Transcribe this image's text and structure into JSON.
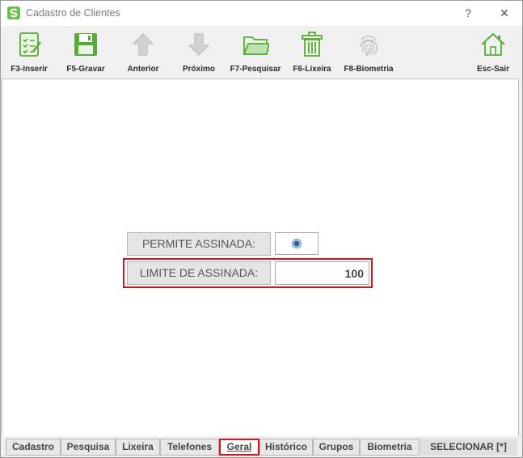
{
  "window": {
    "title": "Cadastro de Clientes",
    "help_glyph": "?",
    "close_glyph": "✕",
    "accent_color": "#6bbf4a"
  },
  "toolbar": {
    "items": [
      {
        "label": "F3-Inserir",
        "icon": "clipboard-check-icon",
        "enabled": true
      },
      {
        "label": "F5-Gravar",
        "icon": "save-icon",
        "enabled": true
      },
      {
        "label": "Anterior",
        "icon": "arrow-up-icon",
        "enabled": false
      },
      {
        "label": "Próximo",
        "icon": "arrow-down-icon",
        "enabled": false
      },
      {
        "label": "F7-Pesquisar",
        "icon": "folder-icon",
        "enabled": true
      },
      {
        "label": "F6-Lixeira",
        "icon": "trash-icon",
        "enabled": true
      },
      {
        "label": "F8-Biometria",
        "icon": "fingerprint-icon",
        "enabled": false
      },
      {
        "label": "Esc-Sair",
        "icon": "home-icon",
        "enabled": true
      }
    ]
  },
  "form": {
    "permite_assinada_label": "PERMITE ASSINADA:",
    "permite_assinada_checked": true,
    "limite_assinada_label": "LIMITE DE ASSINADA:",
    "limite_assinada_value": "100"
  },
  "tabs": {
    "items": [
      {
        "label": "Cadastro"
      },
      {
        "label": "Pesquisa"
      },
      {
        "label": "Lixeira"
      },
      {
        "label": "Telefones"
      },
      {
        "label": "Geral",
        "active": true
      },
      {
        "label": "Histórico"
      },
      {
        "label": "Grupos"
      },
      {
        "label": "Biometria"
      }
    ],
    "select_label": "SELECIONAR [*]"
  }
}
